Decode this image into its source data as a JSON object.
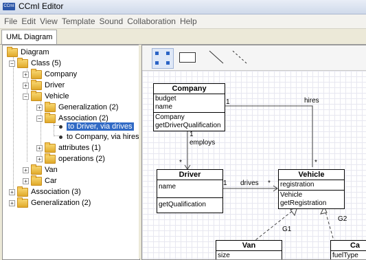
{
  "window": {
    "app_icon_text": "CCmI",
    "title": "CCmI Editor"
  },
  "menu": [
    "File",
    "Edit",
    "View",
    "Template",
    "Sound",
    "Collaboration",
    "Help"
  ],
  "tabs": [
    {
      "label": "UML Diagram"
    }
  ],
  "tree": {
    "diagram": "Diagram",
    "class": "Class (5)",
    "company": "Company",
    "driver": "Driver",
    "vehicle": "Vehicle",
    "generalization_child": "Generalization (2)",
    "association_child": "Association (2)",
    "to_driver": "to Driver, via drives",
    "to_company": "to Company, via hires",
    "attributes": "attributes (1)",
    "operations": "operations (2)",
    "van": "Van",
    "car": "Car",
    "association": "Association (3)",
    "generalization": "Generalization (2)"
  },
  "diagram": {
    "company": {
      "name": "Company",
      "attributes": [
        "budget",
        "name"
      ],
      "operations": [
        "Company",
        "getDriverQualification"
      ]
    },
    "driver": {
      "name": "Driver",
      "attributes": [
        "name"
      ],
      "operations": [
        "getQualification"
      ]
    },
    "vehicle": {
      "name": "Vehicle",
      "attributes": [
        "registration"
      ],
      "operations": [
        "Vehicle",
        "getRegistration"
      ]
    },
    "van": {
      "name": "Van",
      "attributes": [
        "size"
      ]
    },
    "car": {
      "name": "Ca",
      "attributes": [
        "fuelType"
      ]
    },
    "labels": {
      "hires": "hires",
      "hires_mult_company": "1",
      "hires_mult_vehicle": "*",
      "employs": "employs",
      "employs_mult_company": "1",
      "employs_mult_driver": "*",
      "drives": "drives",
      "drives_mult_driver": "1",
      "drives_mult_vehicle": "*",
      "g1": "G1",
      "g2": "G2"
    }
  }
}
